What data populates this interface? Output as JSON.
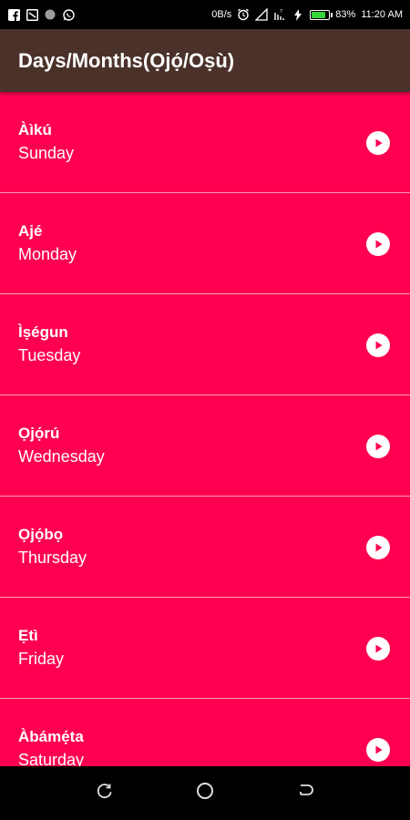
{
  "status_bar": {
    "data_speed": "0B/s",
    "battery_percent_label": "83%",
    "battery_level": 0.83,
    "time": "11:20 AM",
    "left_icons": [
      "facebook-icon",
      "cast-icon",
      "record-icon",
      "whatsapp-icon"
    ],
    "right_icons": [
      "alarm-icon",
      "signal-icon",
      "wifi-icon",
      "charging-icon",
      "battery-icon"
    ]
  },
  "app_bar": {
    "title": "Days/Months(Ọjọ́/Oṣù)"
  },
  "list": {
    "items": [
      {
        "yoruba": "Àìkú",
        "english": "Sunday"
      },
      {
        "yoruba": "Ajé",
        "english": "Monday"
      },
      {
        "yoruba": "Ìṣégun",
        "english": "Tuesday"
      },
      {
        "yoruba": "Ọjọ́rú",
        "english": "Wednesday"
      },
      {
        "yoruba": "Ọjọ́bọ",
        "english": "Thursday"
      },
      {
        "yoruba": "Ẹtì",
        "english": "Friday"
      },
      {
        "yoruba": "Àbámẹ́ta",
        "english": "Saturday"
      }
    ],
    "action_icon": "play-icon"
  },
  "nav_bar": {
    "buttons": [
      "recent-apps-icon",
      "home-icon",
      "back-icon"
    ]
  },
  "colors": {
    "list_background": "#ff0050",
    "app_bar": "#4a3129",
    "divider": "#ff9fb6"
  }
}
